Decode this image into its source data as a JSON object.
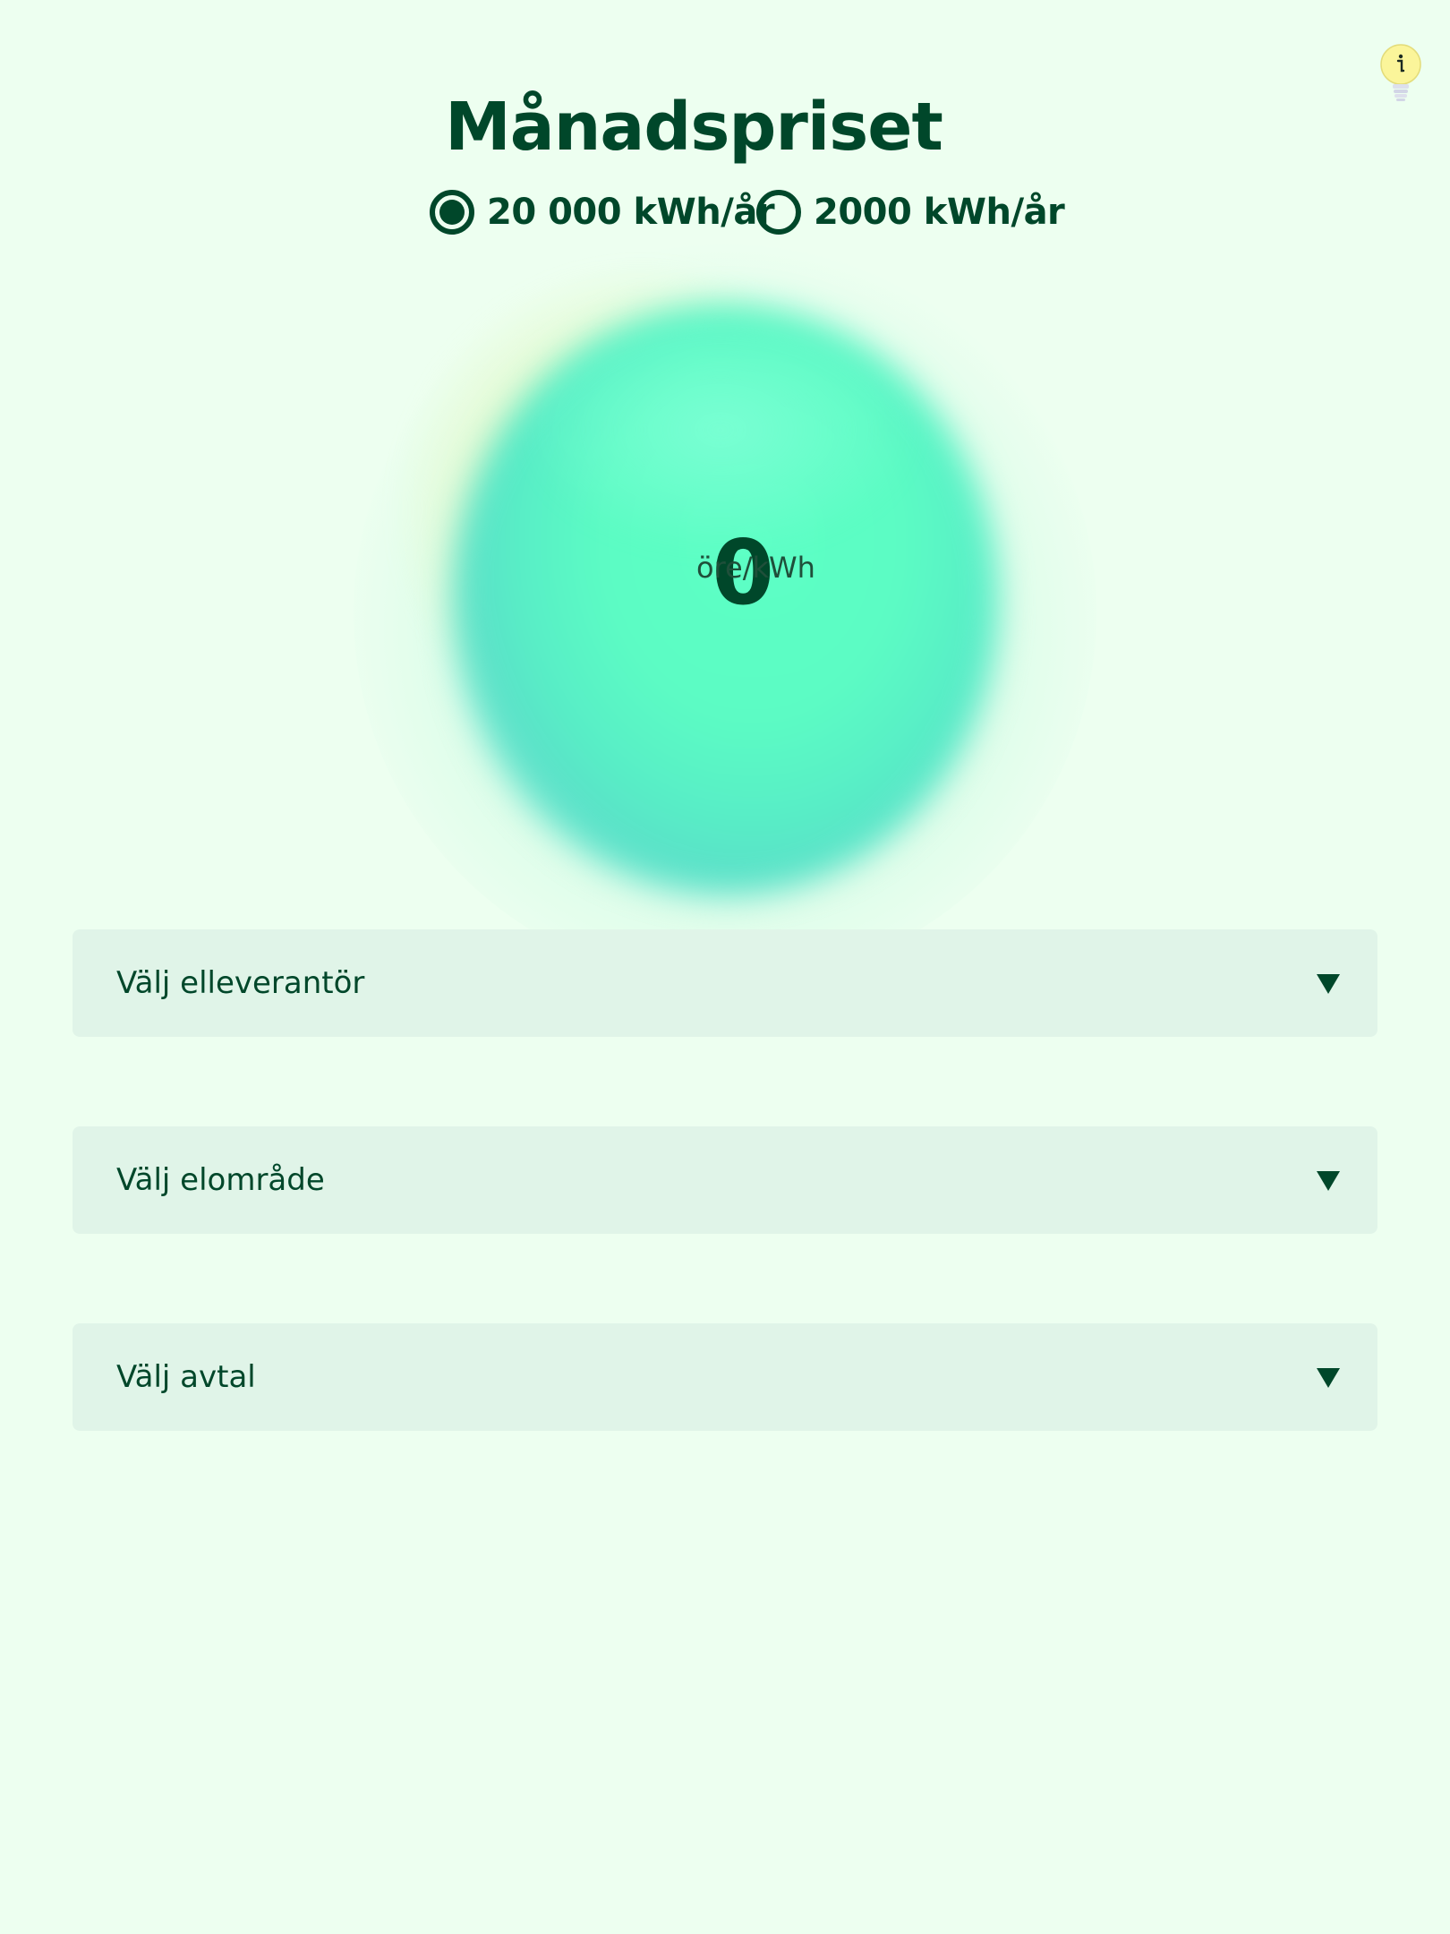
{
  "header": {
    "title": "Månadspriset",
    "info_icon": "lightbulb-info-icon"
  },
  "consumption": {
    "options": [
      {
        "label": "20 000 kWh/år",
        "selected": true
      },
      {
        "label": "2000 kWh/år",
        "selected": false
      }
    ]
  },
  "price": {
    "value": "0",
    "unit": "öre/kWh"
  },
  "selects": {
    "supplier": {
      "label": "Välj elleverantör",
      "icon": "caret-down-icon"
    },
    "area": {
      "label": "Välj elområde",
      "icon": "caret-down-icon"
    },
    "contract": {
      "label": "Välj avtal",
      "icon": "caret-down-icon"
    }
  },
  "colors": {
    "background": "#edfff0",
    "text": "#00472a",
    "select_bg": "#e0f4e8",
    "orb": "#5dffc5",
    "bulb": "#fbf59a"
  }
}
